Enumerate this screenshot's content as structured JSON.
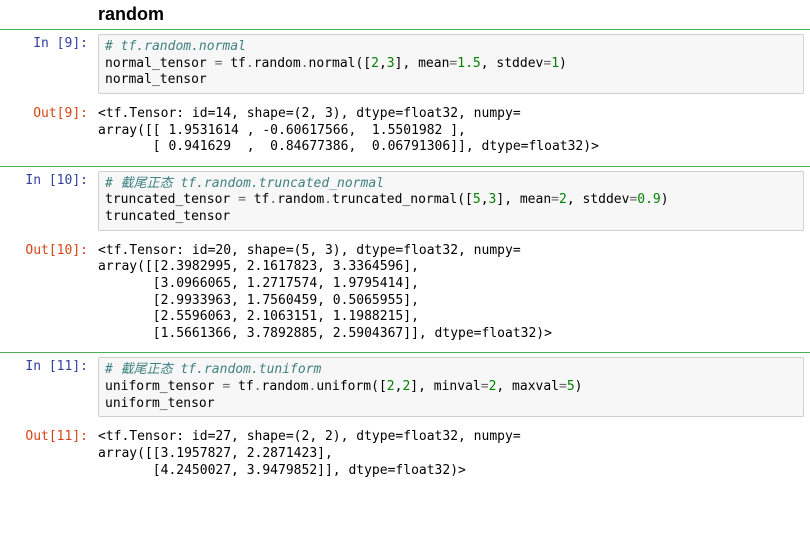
{
  "title": "random",
  "cells": [
    {
      "in_prompt": "In [9]:",
      "out_prompt": "Out[9]:",
      "code": {
        "comment": "# tf.random.normal",
        "line2_a": "normal_tensor ",
        "line2_eq": "=",
        "line2_b": " tf",
        "line2_dot1": ".",
        "line2_c": "random",
        "line2_dot2": ".",
        "line2_d": "normal([",
        "line2_n1": "2",
        "line2_comma": ",",
        "line2_n2": "3",
        "line2_e": "], mean",
        "line2_eq2": "=",
        "line2_n3": "1.5",
        "line2_f": ", stddev",
        "line2_eq3": "=",
        "line2_n4": "1",
        "line2_g": ")",
        "line3": "normal_tensor"
      },
      "output": "<tf.Tensor: id=14, shape=(2, 3), dtype=float32, numpy=\narray([[ 1.9531614 , -0.60617566,  1.5501982 ],\n       [ 0.941629  ,  0.84677386,  0.06791306]], dtype=float32)>"
    },
    {
      "in_prompt": "In [10]:",
      "out_prompt": "Out[10]:",
      "code": {
        "comment": "# 截尾正态 tf.random.truncated_normal",
        "line2_a": "truncated_tensor ",
        "line2_eq": "=",
        "line2_b": " tf",
        "line2_dot1": ".",
        "line2_c": "random",
        "line2_dot2": ".",
        "line2_d": "truncated_normal([",
        "line2_n1": "5",
        "line2_comma": ",",
        "line2_n2": "3",
        "line2_e": "], mean",
        "line2_eq2": "=",
        "line2_n3": "2",
        "line2_f": ", stddev",
        "line2_eq3": "=",
        "line2_n4": "0.9",
        "line2_g": ")",
        "line3": "truncated_tensor"
      },
      "output": "<tf.Tensor: id=20, shape=(5, 3), dtype=float32, numpy=\narray([[2.3982995, 2.1617823, 3.3364596],\n       [3.0966065, 1.2717574, 1.9795414],\n       [2.9933963, 1.7560459, 0.5065955],\n       [2.5596063, 2.1063151, 1.1988215],\n       [1.5661366, 3.7892885, 2.5904367]], dtype=float32)>"
    },
    {
      "in_prompt": "In [11]:",
      "out_prompt": "Out[11]:",
      "code": {
        "comment": "# 截尾正态 tf.random.tuniform",
        "line2_a": "uniform_tensor ",
        "line2_eq": "=",
        "line2_b": " tf",
        "line2_dot1": ".",
        "line2_c": "random",
        "line2_dot2": ".",
        "line2_d": "uniform([",
        "line2_n1": "2",
        "line2_comma": ",",
        "line2_n2": "2",
        "line2_e": "], minval",
        "line2_eq2": "=",
        "line2_n3": "2",
        "line2_f": ", maxval",
        "line2_eq3": "=",
        "line2_n4": "5",
        "line2_g": ")",
        "line3": "uniform_tensor"
      },
      "output": "<tf.Tensor: id=27, shape=(2, 2), dtype=float32, numpy=\narray([[3.1957827, 2.2871423],\n       [4.2450027, 3.9479852]], dtype=float32)>"
    }
  ]
}
